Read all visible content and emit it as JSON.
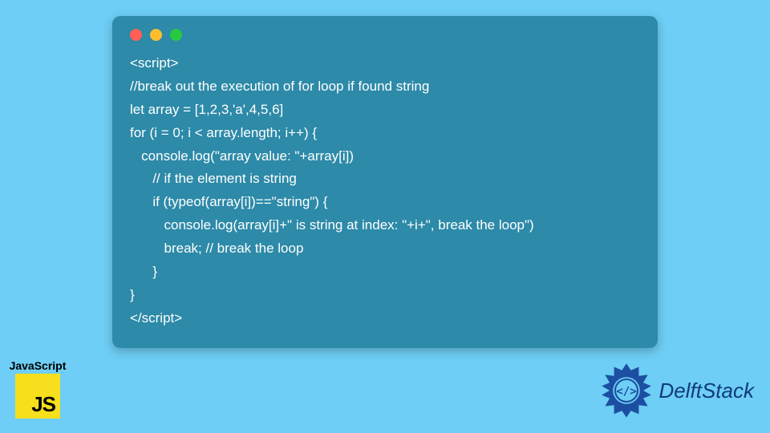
{
  "code_window": {
    "lines": [
      "<script>",
      "//break out the execution of for loop if found string",
      "let array = [1,2,3,'a',4,5,6]",
      "for (i = 0; i < array.length; i++) {",
      "   console.log(\"array value: \"+array[i])",
      "      // if the element is string",
      "      if (typeof(array[i])==\"string\") {",
      "         console.log(array[i]+\" is string at index: \"+i+\", break the loop\")",
      "         break; // break the loop",
      "      }",
      "}",
      "</script>"
    ]
  },
  "js_badge": {
    "label": "JavaScript",
    "logo_text": "JS"
  },
  "brand": {
    "name": "DelftStack"
  },
  "colors": {
    "page_bg": "#6ECEF5",
    "window_bg": "#2D8AA8",
    "code_text": "#FFFFFF",
    "js_yellow": "#F7DF1E",
    "brand_blue": "#103A7B"
  }
}
